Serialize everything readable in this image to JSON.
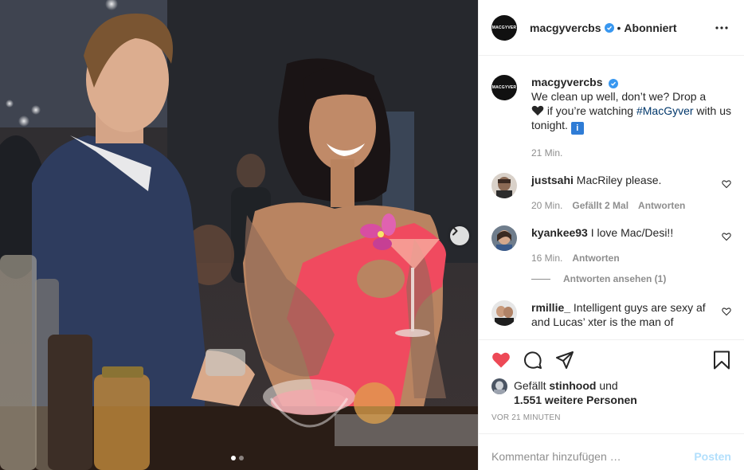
{
  "photo": {
    "alt_hidden": "",
    "carousel_dots": 2,
    "active_dot": 0
  },
  "header": {
    "username": "macgyvercbs",
    "avatar_text": "MACGYVER",
    "separator": "•",
    "follow_status": "Abonniert"
  },
  "caption": {
    "username": "macgyvercbs",
    "text_1": "We clean up well, don’t we? Drop a",
    "text_2": "if you’re watching",
    "hashtag": "#MacGyver",
    "text_3": "with us tonight.",
    "emoji_info": "i",
    "time": "21 Min."
  },
  "comments": [
    {
      "username": "justsahi",
      "text": "MacRiley please.",
      "time": "20 Min.",
      "likes": "Gefällt 2 Mal",
      "reply": "Antworten"
    },
    {
      "username": "kyankee93",
      "text": "I love Mac/Desi!!",
      "time": "16 Min.",
      "reply": "Antworten",
      "view_replies": "Antworten ansehen (1)"
    },
    {
      "username": "rmillie_",
      "text": "Intelligent guys are sexy af and Lucas’ xter is the man of"
    }
  ],
  "likes": {
    "prefix": "Gefällt",
    "user": "stinhood",
    "conj": "und",
    "others": "1.551 weitere Personen"
  },
  "timestamp": "VOR 21 MINUTEN",
  "add_comment": {
    "placeholder": "Kommentar hinzufügen …",
    "post_label": "Posten"
  },
  "colors": {
    "liked_heart": "#ed4956",
    "verified": "#3897f0",
    "link": "#00376b",
    "post_disabled": "#b2dffc"
  }
}
